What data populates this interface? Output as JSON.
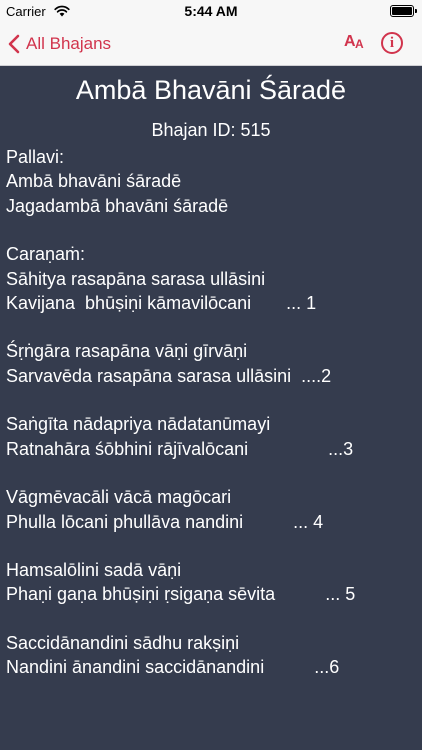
{
  "status_bar": {
    "carrier": "Carrier",
    "time": "5:44 AM"
  },
  "nav": {
    "back_label": "All Bhajans",
    "text_size_label_big": "A",
    "text_size_label_small": "A",
    "info_label": "i"
  },
  "bhajan": {
    "title": "Ambā Bhavāni Śāradē",
    "id_text": "Bhajan ID: 515",
    "lines": [
      "Pallavi:",
      "Ambā bhavāni śāradē",
      "Jagadambā bhavāni śāradē",
      "",
      "Caraṇaṁ:",
      "Sāhitya rasapāna sarasa ullāsini",
      "Kavijana  bhūṣiṇi kāmavilōcani       ... 1",
      "",
      "Śṛṅgāra rasapāna vāṇi gīrvāṇi",
      "Sarvavēda rasapāna sarasa ullāsini  ....2",
      "",
      "Saṅgīta nādapriya nādatanūmayi",
      "Ratnahāra śōbhini rājīvalōcani                ...3",
      "",
      "Vāgmēvacāli vācā magōcari",
      "Phulla lōcani phullāva nandini          ... 4",
      "",
      "Hamsalōlini sadā vāṇi",
      "Phaṇi gaṇa bhūṣiṇi ṛsigaṇa sēvita          ... 5",
      "",
      "Saccidānandini sādhu rakṣiṇi",
      "Nandini ānandini saccidānandini          ...6"
    ]
  },
  "colors": {
    "accent": "#d1344d",
    "background": "#353c4e",
    "text": "#ffffff",
    "bar": "#f7f7f7"
  }
}
